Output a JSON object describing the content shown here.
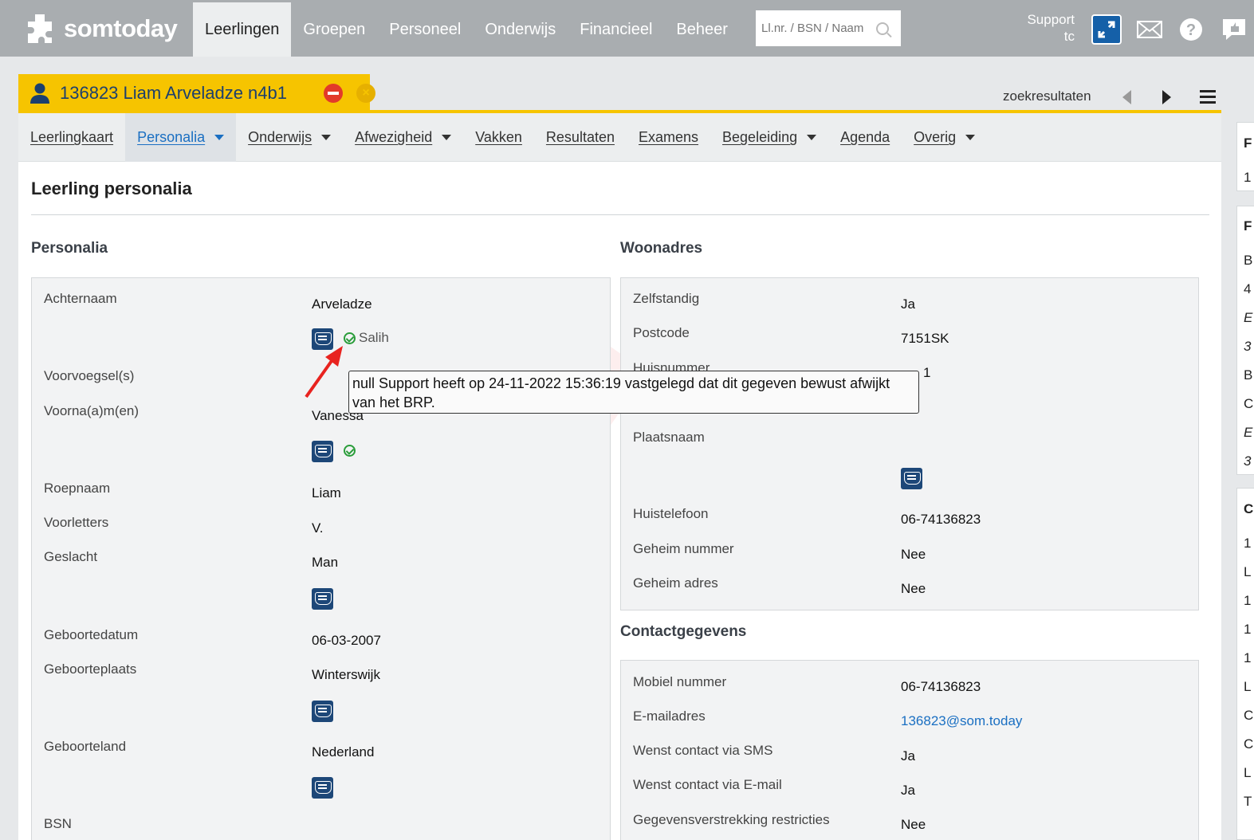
{
  "app": {
    "logo_text": "somtoday",
    "nav": [
      "Leerlingen",
      "Groepen",
      "Personeel",
      "Onderwijs",
      "Financieel",
      "Beheer"
    ],
    "active_nav": "Leerlingen",
    "search_placeholder": "Ll.nr. / BSN / Naam",
    "user_line1": "Support",
    "user_line2": "tc"
  },
  "student": {
    "header": "136823  Liam Arveladze n4b1",
    "search_results_label": "zoekresultaten",
    "close_glyph": "×"
  },
  "subnav": [
    "Leerlingkaart",
    "Personalia",
    "Onderwijs",
    "Afwezigheid",
    "Vakken",
    "Resultaten",
    "Examens",
    "Begeleiding",
    "Agenda",
    "Overig"
  ],
  "page_title": "Leerling personalia",
  "personalia": {
    "section_title": "Personalia",
    "fields": [
      {
        "label": "Achternaam",
        "value": "Arveladze"
      },
      {
        "label": "Voorvoegsel(s)",
        "value": ""
      },
      {
        "label": "Voorna(a)m(en)",
        "value": "Vanessa"
      },
      {
        "label": "Roepnaam",
        "value": "Liam"
      },
      {
        "label": "Voorletters",
        "value": "V."
      },
      {
        "label": "Geslacht",
        "value": "Man"
      },
      {
        "label": "Geboortedatum",
        "value": "06-03-2007"
      },
      {
        "label": "Geboorteplaats",
        "value": "Winterswijk"
      },
      {
        "label": "Geboorteland",
        "value": "Nederland"
      },
      {
        "label": "BSN",
        "value": ""
      }
    ],
    "brp_note": "Salih"
  },
  "woonadres": {
    "section_title": "Woonadres",
    "fields": [
      {
        "label": "Zelfstandig",
        "value": "Ja"
      },
      {
        "label": "Postcode",
        "value": "7151SK"
      },
      {
        "label": "Huisnummer",
        "value": "1"
      },
      {
        "label": "Plaatsnaam",
        "value": ""
      },
      {
        "label": "Huistelefoon",
        "value": "06-74136823"
      },
      {
        "label": "Geheim nummer",
        "value": "Nee"
      },
      {
        "label": "Geheim adres",
        "value": "Nee"
      }
    ]
  },
  "contact": {
    "section_title": "Contactgegevens",
    "fields": [
      {
        "label": "Mobiel nummer",
        "value": "06-74136823"
      },
      {
        "label": "E-mailadres",
        "value": "136823@som.today"
      },
      {
        "label": "Wenst contact via SMS",
        "value": "Ja"
      },
      {
        "label": "Wenst contact via E-mail",
        "value": "Ja"
      },
      {
        "label": "Gegevensverstrekking restricties",
        "value": "Nee"
      }
    ]
  },
  "tooltip": "null Support heeft op 24-11-2022 15:36:19 vastgelegd dat dit gegeven bewust afwijkt van het BRP.",
  "right_column": {
    "panel1": [
      "F",
      "1"
    ],
    "panel2": [
      "F",
      "B",
      "4",
      "E",
      "3",
      "B",
      "C",
      "E",
      "3"
    ],
    "panel3": [
      "C",
      "1",
      "L",
      "1",
      "1",
      "1",
      "L",
      "C",
      "C",
      "L",
      "T"
    ]
  },
  "colors": {
    "topbar": "#a9adb0",
    "student_tab": "#f6c400",
    "accent": "#1a6fc2",
    "brp_badge": "#1d4778"
  }
}
